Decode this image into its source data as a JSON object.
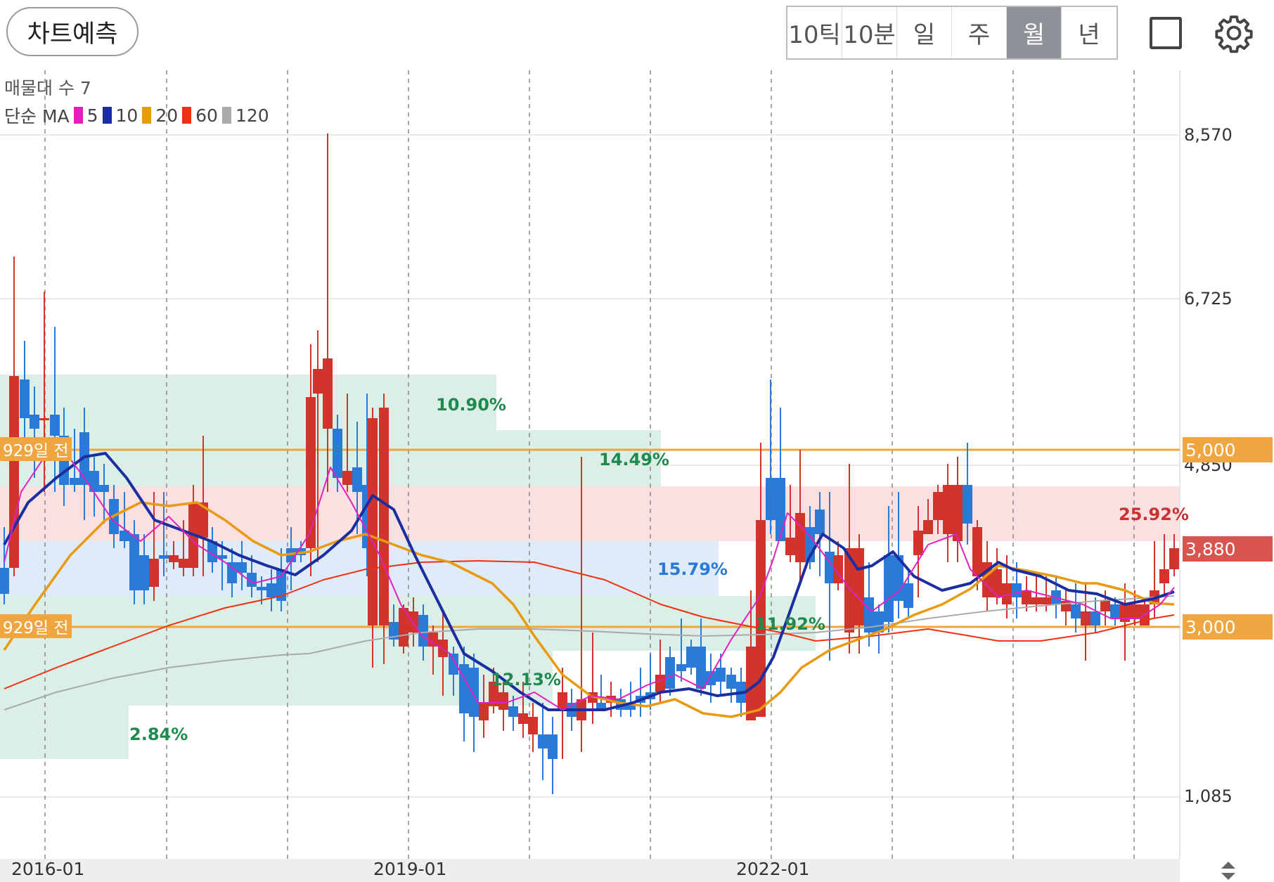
{
  "toolbar": {
    "predict_label": "차트예측",
    "periods": [
      "10틱",
      "10분",
      "일",
      "주",
      "월",
      "년"
    ],
    "active_period": "월",
    "icons": [
      "square-icon",
      "gear-icon"
    ]
  },
  "legend": {
    "volume_label": "매물대 수 7",
    "ma_prefix": "단순 MA",
    "ma": [
      {
        "period": "5",
        "color": "#e020c0"
      },
      {
        "period": "10",
        "color": "#1a2ea0"
      },
      {
        "period": "20",
        "color": "#e89a10"
      },
      {
        "period": "60",
        "color": "#f03010"
      },
      {
        "period": "120",
        "color": "#aaaaaa"
      }
    ]
  },
  "price_axis": {
    "ticks": [
      "8,570",
      "6,725",
      "4,850",
      "1,085"
    ],
    "line_5000": "5,000",
    "current_price": "3,880",
    "line_3000": "3,000"
  },
  "horizontal_lines": {
    "upper_label": "929일 전",
    "lower_label": "929일 전"
  },
  "x_axis": {
    "labels": [
      "2016-01",
      "2019-01",
      "2022-01"
    ]
  },
  "volume_profile": [
    {
      "pct": "10.90%",
      "color": "green"
    },
    {
      "pct": "14.49%",
      "color": "green"
    },
    {
      "pct": "25.92%",
      "color": "red"
    },
    {
      "pct": "15.79%",
      "color": "blue"
    },
    {
      "pct": "11.92%",
      "color": "green"
    },
    {
      "pct": "12.13%",
      "color": "green"
    },
    {
      "pct": "2.84%",
      "color": "green"
    }
  ],
  "colors": {
    "up": "#d0342c",
    "down": "#2a7ad8",
    "level_line": "#f0a640",
    "current_tag": "#d9534f"
  }
}
